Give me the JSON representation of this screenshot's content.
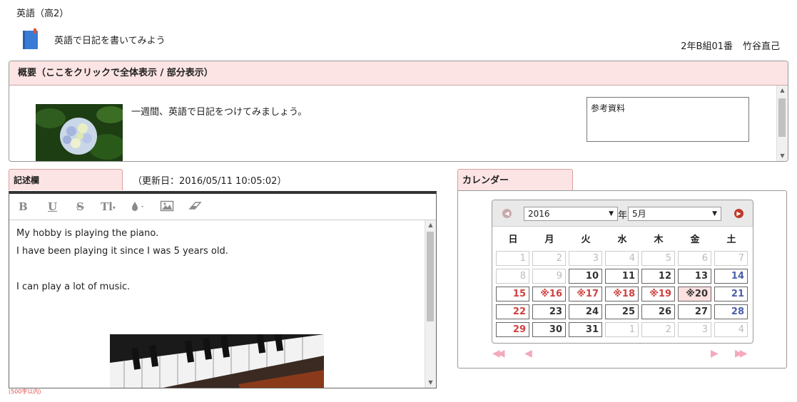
{
  "subject": "英語（高2）",
  "assignment": {
    "title": "英語で日記を書いてみよう"
  },
  "student": {
    "class": "2年B組01番",
    "name": "竹谷直己"
  },
  "overview": {
    "heading": "概要（ここをクリックで全体表示 / 部分表示）",
    "text": "一週間、英語で日記をつけてみましょう。",
    "reference_label": "参考資料"
  },
  "entry": {
    "tab_label": "記述欄",
    "updated": "（更新日：2016/05/11 10:05:02）",
    "toolbar": {
      "bold": "B",
      "underline": "U",
      "strike": "S",
      "text_size": "Tl"
    },
    "lines": [
      "My hobby is playing the piano.",
      "I have been playing it since I was 5 years old.",
      "",
      "I can play a lot of music."
    ],
    "char_limit": "(500字以内)"
  },
  "calendar": {
    "tab_label": "カレンダー",
    "year": "2016",
    "year_suffix": "年",
    "month": "5月",
    "weekdays": [
      "日",
      "月",
      "火",
      "水",
      "木",
      "金",
      "土"
    ],
    "weeks": [
      [
        {
          "d": "1",
          "s": "past"
        },
        {
          "d": "2",
          "s": "past"
        },
        {
          "d": "3",
          "s": "past"
        },
        {
          "d": "4",
          "s": "past"
        },
        {
          "d": "5",
          "s": "past"
        },
        {
          "d": "6",
          "s": "past"
        },
        {
          "d": "7",
          "s": "past"
        }
      ],
      [
        {
          "d": "8",
          "s": "past"
        },
        {
          "d": "9",
          "s": "past"
        },
        {
          "d": "10",
          "s": "normal"
        },
        {
          "d": "11",
          "s": "normal"
        },
        {
          "d": "12",
          "s": "normal"
        },
        {
          "d": "13",
          "s": "normal"
        },
        {
          "d": "14",
          "s": "sat"
        }
      ],
      [
        {
          "d": "15",
          "s": "sun"
        },
        {
          "d": "※16",
          "s": "due"
        },
        {
          "d": "※17",
          "s": "due"
        },
        {
          "d": "※18",
          "s": "due"
        },
        {
          "d": "※19",
          "s": "due"
        },
        {
          "d": "※20",
          "s": "today"
        },
        {
          "d": "21",
          "s": "sat"
        }
      ],
      [
        {
          "d": "22",
          "s": "sun"
        },
        {
          "d": "23",
          "s": "normal"
        },
        {
          "d": "24",
          "s": "normal"
        },
        {
          "d": "25",
          "s": "normal"
        },
        {
          "d": "26",
          "s": "normal"
        },
        {
          "d": "27",
          "s": "normal"
        },
        {
          "d": "28",
          "s": "sat"
        }
      ],
      [
        {
          "d": "29",
          "s": "sun"
        },
        {
          "d": "30",
          "s": "normal"
        },
        {
          "d": "31",
          "s": "normal"
        },
        {
          "d": "1",
          "s": "other"
        },
        {
          "d": "2",
          "s": "other"
        },
        {
          "d": "3",
          "s": "other"
        },
        {
          "d": "4",
          "s": "other"
        }
      ]
    ]
  },
  "colors": {
    "accent_pink": "#fde4e4",
    "sunday_red": "#d04040",
    "saturday_blue": "#4a5fa8",
    "nav_red": "#c0392b"
  }
}
